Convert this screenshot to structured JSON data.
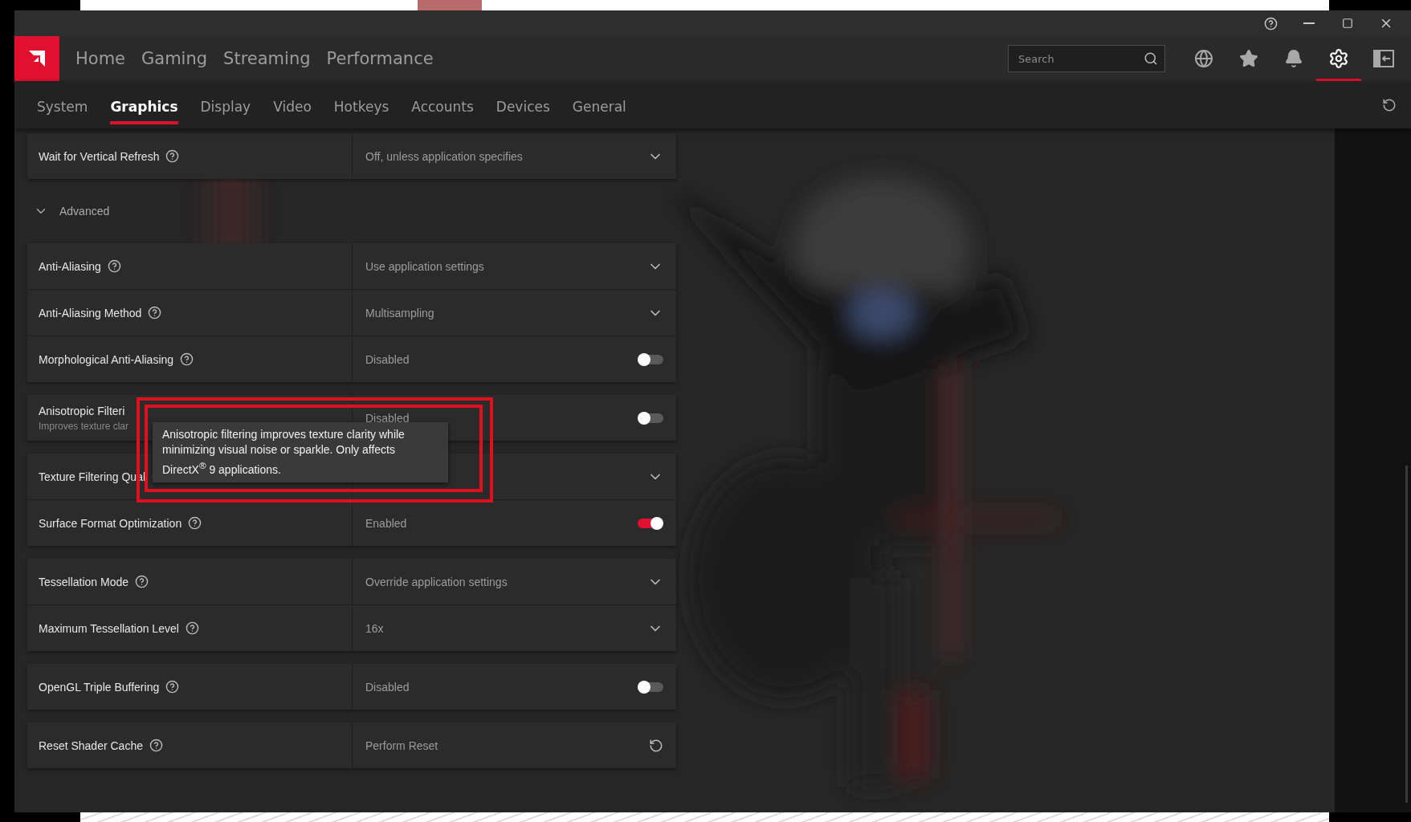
{
  "nav": {
    "items": [
      {
        "label": "Home",
        "selected": false
      },
      {
        "label": "Gaming",
        "selected": false
      },
      {
        "label": "Streaming",
        "selected": false
      },
      {
        "label": "Performance",
        "selected": false
      }
    ],
    "search": {
      "placeholder": "Search"
    },
    "icons": [
      {
        "kind": "globe",
        "selected": false
      },
      {
        "kind": "star",
        "selected": false
      },
      {
        "kind": "bell",
        "selected": false
      },
      {
        "kind": "settings",
        "selected": true
      },
      {
        "kind": "panel",
        "selected": false
      }
    ]
  },
  "subtabs": [
    {
      "label": "System",
      "selected": false
    },
    {
      "label": "Graphics",
      "selected": true
    },
    {
      "label": "Display",
      "selected": false
    },
    {
      "label": "Video",
      "selected": false
    },
    {
      "label": "Hotkeys",
      "selected": false
    },
    {
      "label": "Accounts",
      "selected": false
    },
    {
      "label": "Devices",
      "selected": false
    },
    {
      "label": "General",
      "selected": false
    }
  ],
  "sections": [
    {
      "kind": "card",
      "rows": [
        {
          "kind": "dropdown",
          "label": "Wait for Vertical Refresh",
          "value": "Off, unless application specifies"
        }
      ]
    },
    {
      "kind": "header",
      "label": "Advanced",
      "expanded": true
    },
    {
      "kind": "card",
      "rows": [
        {
          "kind": "dropdown",
          "label": "Anti-Aliasing",
          "value": "Use application settings"
        },
        {
          "kind": "dropdown",
          "label": "Anti-Aliasing Method",
          "value": "Multisampling"
        },
        {
          "kind": "toggle",
          "label": "Morphological Anti-Aliasing",
          "value": "Disabled",
          "on": false
        }
      ]
    },
    {
      "kind": "card",
      "rows": [
        {
          "kind": "toggle",
          "label": "Anisotropic Filteri",
          "sub": "Improves texture clar",
          "value": "Disabled",
          "on": false
        }
      ]
    },
    {
      "kind": "card",
      "rows": [
        {
          "kind": "dropdown",
          "label": "Texture Filtering Qual"
        },
        {
          "kind": "toggle",
          "label": "Surface Format Optimization",
          "value": "Enabled",
          "on": true
        }
      ]
    },
    {
      "kind": "card",
      "rows": [
        {
          "kind": "dropdown",
          "label": "Tessellation Mode",
          "value": "Override application settings"
        },
        {
          "kind": "dropdown",
          "label": "Maximum Tessellation Level",
          "value": "16x"
        }
      ]
    },
    {
      "kind": "card",
      "rows": [
        {
          "kind": "toggle",
          "label": "OpenGL Triple Buffering",
          "value": "Disabled",
          "on": false
        }
      ]
    },
    {
      "kind": "card",
      "rows": [
        {
          "kind": "action",
          "label": "Reset Shader Cache",
          "value": "Perform Reset"
        }
      ]
    }
  ],
  "tooltip": {
    "text": "Anisotropic filtering improves texture clarity while minimizing visual noise or sparkle. Only affects DirectX$^{®}$ 9 applications."
  }
}
